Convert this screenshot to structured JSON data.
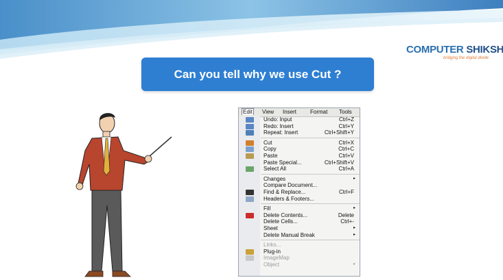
{
  "slide": {
    "question": "Can you tell why we use Cut ?"
  },
  "logo": {
    "part1": "COMPUTER",
    "part2": "SHIKSHA",
    "tagline": "bridging the digital divide"
  },
  "menubar": [
    {
      "label": "Edit",
      "active": true
    },
    {
      "label": "View"
    },
    {
      "label": "Insert"
    },
    {
      "label": "Format"
    },
    {
      "label": "Tools"
    }
  ],
  "menu_groups": [
    [
      {
        "label": "Undo: Input",
        "shortcut": "Ctrl+Z",
        "icon": "undo-icon",
        "color": "#5b86c4"
      },
      {
        "label": "Redo: Insert",
        "shortcut": "Ctrl+Y",
        "icon": "redo-icon",
        "color": "#5b86c4"
      },
      {
        "label": "Repeat: Insert",
        "shortcut": "Ctrl+Shift+Y",
        "icon": "repeat-icon",
        "color": "#4f7fb8"
      }
    ],
    [
      {
        "label": "Cut",
        "shortcut": "Ctrl+X",
        "icon": "scissors-icon",
        "color": "#d0802c"
      },
      {
        "label": "Copy",
        "shortcut": "Ctrl+C",
        "icon": "copy-icon",
        "color": "#7ba1cf"
      },
      {
        "label": "Paste",
        "shortcut": "Ctrl+V",
        "icon": "paste-icon",
        "color": "#b99a52"
      },
      {
        "label": "Paste Special...",
        "shortcut": "Ctrl+Shift+V"
      },
      {
        "label": "Select All",
        "shortcut": "Ctrl+A",
        "icon": "select-all-icon",
        "color": "#6aa56a"
      }
    ],
    [
      {
        "label": "Changes",
        "submenu": true
      },
      {
        "label": "Compare Document..."
      },
      {
        "label": "Find & Replace...",
        "shortcut": "Ctrl+F",
        "icon": "binoculars-icon",
        "color": "#333333"
      },
      {
        "label": "Headers & Footers...",
        "icon": "headers-footers-icon",
        "color": "#8fa7c6"
      }
    ],
    [
      {
        "label": "Fill",
        "submenu": true
      },
      {
        "label": "Delete Contents...",
        "shortcut": "Delete",
        "icon": "delete-x-icon",
        "color": "#cc2b2b"
      },
      {
        "label": "Delete Cells...",
        "shortcut": "Ctrl+-"
      },
      {
        "label": "Sheet",
        "submenu": true
      },
      {
        "label": "Delete Manual Break",
        "submenu": true
      }
    ],
    [
      {
        "label": "Links...",
        "disabled": true
      },
      {
        "label": "Plug-in",
        "icon": "plugin-icon",
        "color": "#c9a23a"
      },
      {
        "label": "ImageMap",
        "disabled": true,
        "icon": "imagemap-icon",
        "color": "#c8c8c8"
      },
      {
        "label": "Object",
        "disabled": true,
        "submenu": true
      }
    ]
  ]
}
